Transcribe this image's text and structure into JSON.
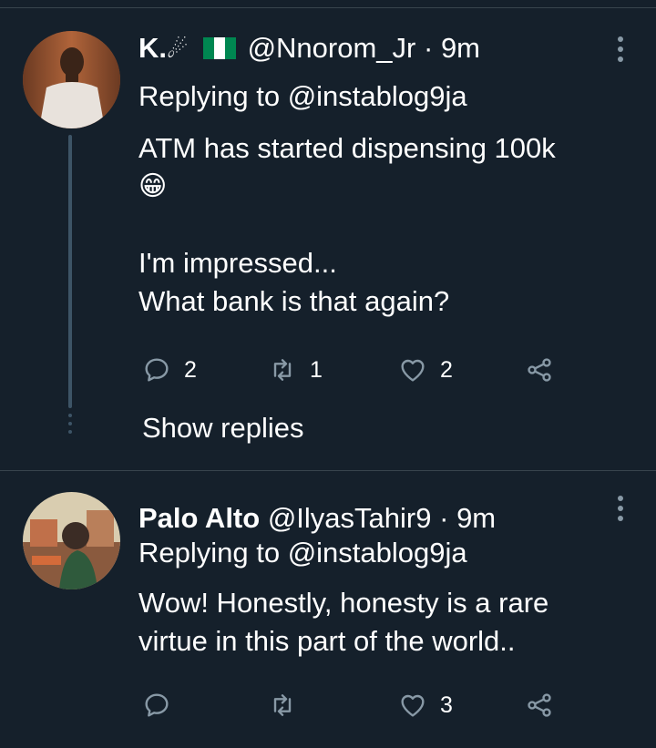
{
  "tweets": [
    {
      "name": "K.",
      "name_glyph": "☄",
      "handle": "@Nnorom_Jr",
      "separator": "·",
      "time": "9m",
      "replying_to": "Replying to @instablog9ja",
      "body_lines": [
        "ATM has started dispensing 100k",
        "😁",
        "",
        "I'm impressed...",
        "What bank is that again?"
      ],
      "reply_count": "2",
      "retweet_count": "1",
      "like_count": "2",
      "show_replies": "Show replies"
    },
    {
      "name": "Palo Alto",
      "handle": "@IlyasTahir9",
      "separator": "·",
      "time": "9m",
      "replying_to": "Replying to @instablog9ja",
      "body_lines": [
        "Wow! Honestly, honesty is a rare",
        "virtue in this part of the world.."
      ],
      "reply_count": "",
      "retweet_count": "",
      "like_count": "3"
    }
  ],
  "icons": {
    "reply": "reply-icon",
    "retweet": "retweet-icon",
    "like": "heart-icon",
    "share": "share-icon",
    "more": "more-vertical-icon"
  },
  "colors": {
    "background": "#15202b",
    "divider": "#38444d",
    "muted": "#8899a6",
    "nigeria_green": "#008751"
  }
}
